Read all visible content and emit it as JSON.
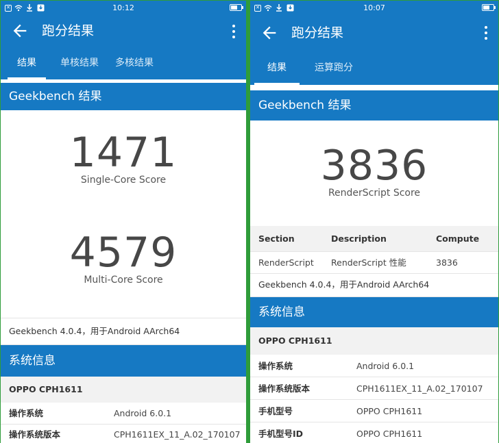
{
  "left": {
    "status": {
      "time": "10:12"
    },
    "appbar": {
      "title": "跑分结果"
    },
    "tabs": [
      {
        "label": "结果"
      },
      {
        "label": "单核结果"
      },
      {
        "label": "多核结果"
      }
    ],
    "section_title": "Geekbench 结果",
    "single_score": "1471",
    "single_label": "Single-Core Score",
    "multi_score": "4579",
    "multi_label": "Multi-Core Score",
    "version_note": "Geekbench 4.0.4，用于Android AArch64",
    "sysinfo_title": "系统信息",
    "device": "OPPO CPH1611",
    "rows": [
      {
        "key": "操作系统",
        "value": "Android 6.0.1"
      },
      {
        "key": "操作系统版本",
        "value": "CPH1611EX_11_A.02_170107"
      }
    ]
  },
  "right": {
    "status": {
      "time": "10:07"
    },
    "appbar": {
      "title": "跑分结果"
    },
    "tabs": [
      {
        "label": "结果"
      },
      {
        "label": "运算跑分"
      }
    ],
    "section_title": "Geekbench 结果",
    "score": "3836",
    "score_label": "RenderScript Score",
    "table": {
      "headers": [
        "Section",
        "Description",
        "Compute"
      ],
      "row": [
        "RenderScript",
        "RenderScript 性能",
        "3836"
      ]
    },
    "version_note": "Geekbench 4.0.4，用于Android AArch64",
    "sysinfo_title": "系统信息",
    "device": "OPPO CPH1611",
    "rows": [
      {
        "key": "操作系统",
        "value": "Android 6.0.1"
      },
      {
        "key": "操作系统版本",
        "value": "CPH1611EX_11_A.02_170107"
      },
      {
        "key": "手机型号",
        "value": "OPPO CPH1611"
      },
      {
        "key": "手机型号ID",
        "value": "OPPO CPH1611"
      }
    ]
  },
  "colors": {
    "primary": "#1679c3",
    "frame": "#2f9c3a"
  },
  "icons": {
    "status": [
      "notification-icon",
      "wifi-icon",
      "download-icon",
      "download-box-icon",
      "battery-icon"
    ],
    "appbar": [
      "back-arrow-icon",
      "overflow-menu-icon"
    ]
  }
}
